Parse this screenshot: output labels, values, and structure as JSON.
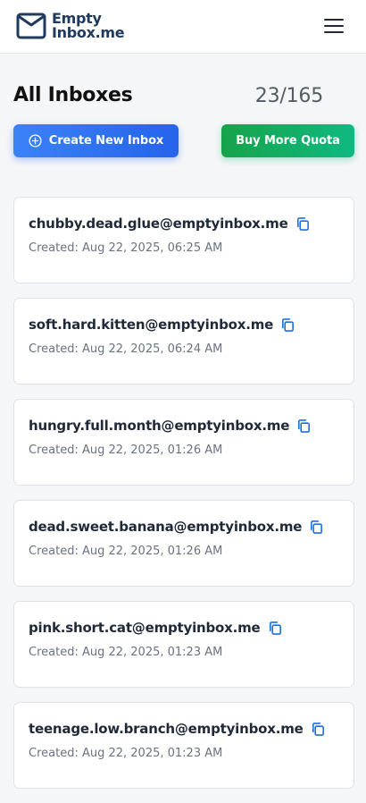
{
  "header": {
    "logo_line1": "Empty",
    "logo_line2": "Inbox.me",
    "menu_icon": "hamburger-menu-icon"
  },
  "main": {
    "title": "All Inboxes",
    "quota": "23/165",
    "create_button_label": "Create New Inbox",
    "buy_button_label": "Buy More Quota",
    "inboxes": [
      {
        "email": "chubby.dead.glue@emptyinbox.me",
        "created": "Created: Aug 22, 2025, 06:25 AM"
      },
      {
        "email": "soft.hard.kitten@emptyinbox.me",
        "created": "Created: Aug 22, 2025, 06:24 AM"
      },
      {
        "email": "hungry.full.month@emptyinbox.me",
        "created": "Created: Aug 22, 2025, 01:26 AM"
      },
      {
        "email": "dead.sweet.banana@emptyinbox.me",
        "created": "Created: Aug 22, 2025, 01:26 AM"
      },
      {
        "email": "pink.short.cat@emptyinbox.me",
        "created": "Created: Aug 22, 2025, 01:23 AM"
      },
      {
        "email": "teenage.low.branch@emptyinbox.me",
        "created": "Created: Aug 22, 2025, 01:23 AM"
      }
    ]
  },
  "colors": {
    "primary_blue": "#2563eb",
    "success_green": "#10b981",
    "copy_icon_blue": "#1d6fe0"
  }
}
